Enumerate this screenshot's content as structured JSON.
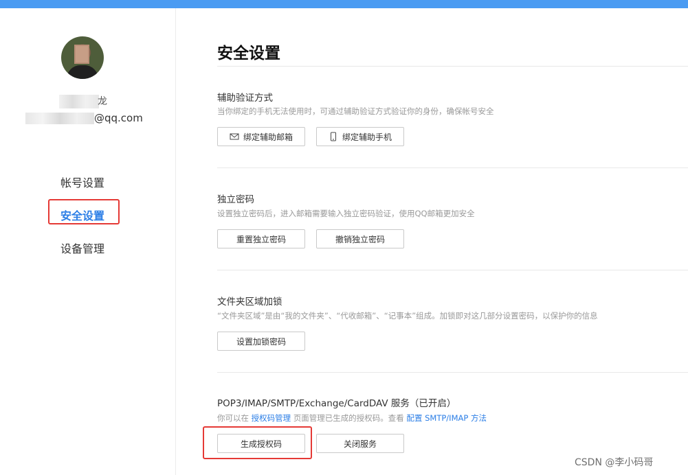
{
  "sidebar": {
    "name_tail": "龙",
    "email_tail": "@qq.com",
    "nav": [
      {
        "label": "帐号设置"
      },
      {
        "label": "安全设置"
      },
      {
        "label": "设备管理"
      }
    ]
  },
  "main": {
    "title": "安全设置",
    "sections": [
      {
        "title": "辅助验证方式",
        "desc": "当你绑定的手机无法使用时，可通过辅助验证方式验证你的身份，确保帐号安全",
        "buttons": [
          {
            "label": "绑定辅助邮箱",
            "icon": "mail-icon"
          },
          {
            "label": "绑定辅助手机",
            "icon": "phone-icon"
          }
        ]
      },
      {
        "title": "独立密码",
        "desc": "设置独立密码后，进入邮箱需要输入独立密码验证，使用QQ邮箱更加安全",
        "buttons": [
          {
            "label": "重置独立密码"
          },
          {
            "label": "撤销独立密码"
          }
        ]
      },
      {
        "title": "文件夹区域加锁",
        "desc": "“文件夹区域”是由“我的文件夹”、“代收邮箱”、“记事本”组成。加锁即对这几部分设置密码，以保护你的信息",
        "buttons": [
          {
            "label": "设置加锁密码"
          }
        ]
      },
      {
        "title": "POP3/IMAP/SMTP/Exchange/CardDAV 服务（已开启）",
        "desc_pre": "你可以在",
        "desc_link1": "授权码管理",
        "desc_mid": "页面管理已生成的授权码。查看",
        "desc_link2": "配置 SMTP/IMAP 方法",
        "buttons": [
          {
            "label": "生成授权码"
          },
          {
            "label": "关闭服务"
          }
        ]
      }
    ]
  },
  "watermark": "CSDN @李小码哥",
  "colors": {
    "accent": "#2b7ee6",
    "topbar": "#4a9bf2",
    "highlight": "#e53935"
  }
}
